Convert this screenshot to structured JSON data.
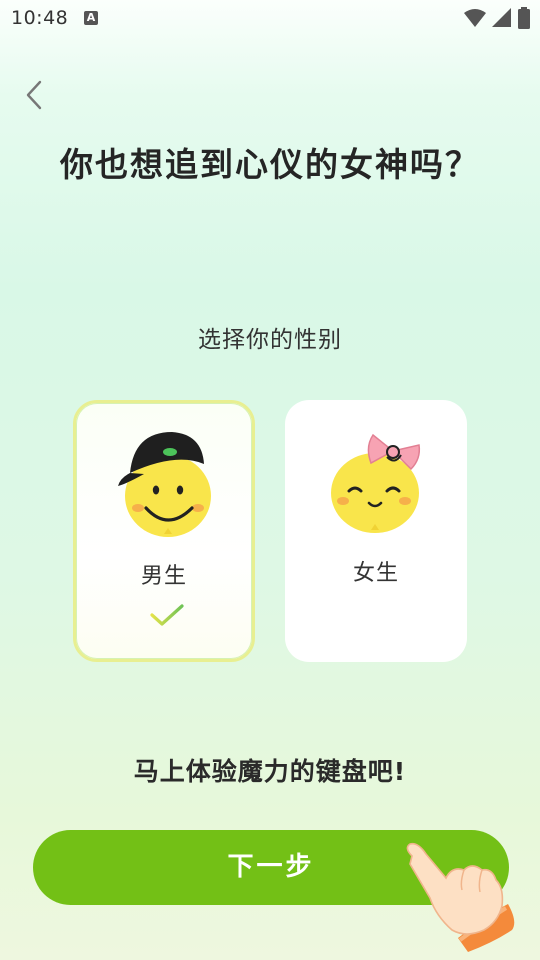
{
  "status_bar": {
    "time": "10:48",
    "notification_icon": "A"
  },
  "header": {
    "back_icon": "chevron-left-icon",
    "title": "你也想追到心仪的女神吗？"
  },
  "gender_select": {
    "prompt": "选择你的性别",
    "options": [
      {
        "label": "男生",
        "selected": true,
        "icon": "boy-emoji-icon"
      },
      {
        "label": "女生",
        "selected": false,
        "icon": "girl-emoji-icon"
      }
    ]
  },
  "promo_text": "马上体验魔力的键盘吧!",
  "next_button": {
    "label": "下一步"
  },
  "colors": {
    "accent_green": "#73c016",
    "selected_border": "#e8ef91",
    "face_yellow": "#f9e54b"
  }
}
